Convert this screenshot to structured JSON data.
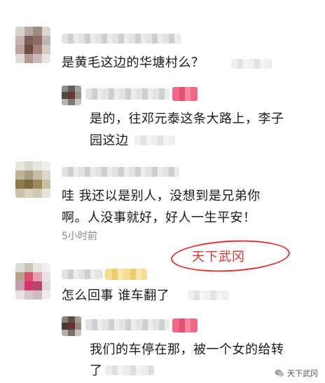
{
  "comments": [
    {
      "id": "c1",
      "text": "是黄毛这边的华塘村么？",
      "reply": {
        "text_line1": "是的，往邓元泰这条大路上，李子",
        "text_line2": "园这边"
      }
    },
    {
      "id": "c2",
      "text_line1": "哇 我还以是别人，没想到是兄弟你",
      "text_line2": "啊。人没事就好，好人一生平安！",
      "time": "5小时前"
    },
    {
      "id": "c3",
      "text": "怎么回事 谁车翻了",
      "reply": {
        "text_line1": "我们的车停在那，被一个女的给转",
        "text_line2": "了"
      }
    }
  ],
  "stamp": {
    "label": "天下武冈",
    "color": "#e5312b"
  },
  "watermark": {
    "label": "天下武冈",
    "icon": "wechat-icon"
  }
}
